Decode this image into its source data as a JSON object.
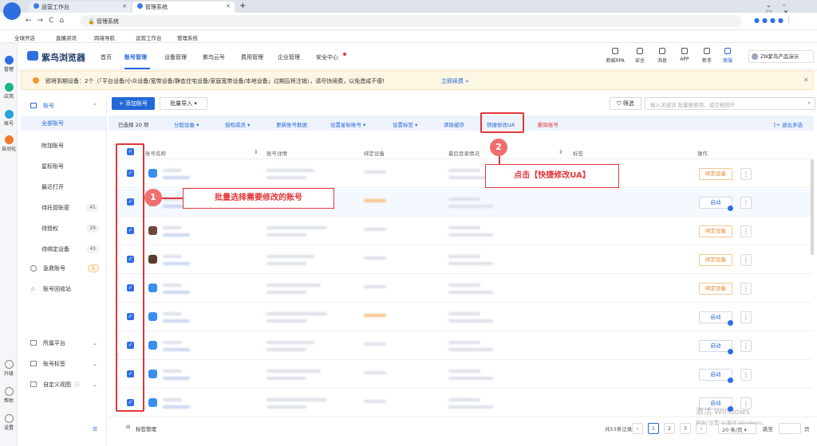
{
  "browser": {
    "tabs": [
      {
        "label": "运营工作台"
      },
      {
        "label": "管理系统"
      }
    ],
    "address": "管理系统",
    "bookmarks": [
      "全球开店",
      "直播资讯",
      "跨境导航",
      "运营工作台",
      "管理系统"
    ]
  },
  "rail": [
    {
      "label": "管理"
    },
    {
      "label": "应用"
    },
    {
      "label": "账号"
    },
    {
      "label": "自动化"
    },
    {
      "label": "升级"
    },
    {
      "label": "帮助"
    },
    {
      "label": "设置"
    }
  ],
  "app": {
    "brand": "紫鸟浏览器",
    "nav": [
      "首页",
      "账号管理",
      "设备管理",
      "紫鸟云号",
      "费用管理",
      "企业管理",
      "安全中心"
    ],
    "tools": [
      "商城RPA",
      "安全",
      "消息",
      "APP",
      "新手",
      "客服"
    ],
    "user": "ZN紫鸟产品演示"
  },
  "notice": {
    "text": "即将到期设备：2个（「平台设备/小众设备/宽带设备/静态住宅设备/家庭宽带设备/本地设备」过期后将注销），请尽快续费，以免造成不便!",
    "link": "立即续费 »"
  },
  "sidebar": {
    "group": "账号",
    "items": [
      {
        "label": "全部账号"
      },
      {
        "label": "附加账号"
      },
      {
        "label": "星标账号"
      },
      {
        "label": "最近打开"
      },
      {
        "label": "待托管账密",
        "badge": "41"
      },
      {
        "label": "待授权",
        "badge": "29"
      },
      {
        "label": "待绑定设备",
        "badge": "43"
      }
    ],
    "groups2": [
      {
        "label": "急救账号",
        "badge": "5"
      },
      {
        "label": "账号回收站"
      }
    ],
    "bottom": [
      {
        "label": "所属平台"
      },
      {
        "label": "账号标签"
      },
      {
        "label": "自定义视图"
      }
    ],
    "footer": "标签管理"
  },
  "toolbar": {
    "add": "+ 添加账号",
    "batch": "批量导入",
    "filter": "筛选",
    "search_placeholder": "输入关键词 批量搜索用、或空格隔开"
  },
  "actions": {
    "selected": "已选择 20 项",
    "items": [
      "分配设备",
      "授权成员",
      "更新账号数据",
      "设置星标账号",
      "设置标签",
      "清除缓存",
      "快捷修改UA",
      "删除账号"
    ],
    "exit": "[+ 退出多选"
  },
  "table": {
    "headers": [
      "账号名称",
      "账号详情",
      "绑定设备",
      "最后登录情况",
      "标签",
      "操作"
    ],
    "rows": [
      {
        "op": "绑定设备"
      },
      {
        "op": "启动"
      },
      {
        "op": "绑定设备"
      },
      {
        "op": "绑定设备"
      },
      {
        "op": "绑定设备"
      },
      {
        "op": "启动"
      },
      {
        "op": "启动"
      },
      {
        "op": "启动"
      },
      {
        "op": "启动"
      }
    ]
  },
  "annotations": {
    "step1": "1",
    "label1": "批量选择需要修改的账号",
    "step2": "2",
    "label2": "点击【快捷修改UA】"
  },
  "footer": {
    "total": "共53条记录",
    "pages": [
      "1",
      "2",
      "3"
    ],
    "per_page": "20 条/页",
    "jump": "跳至",
    "page_suffix": "页"
  },
  "watermark": {
    "line1": "激活 Windows",
    "line2": "转到\"设置\"以激活 Windows。"
  }
}
